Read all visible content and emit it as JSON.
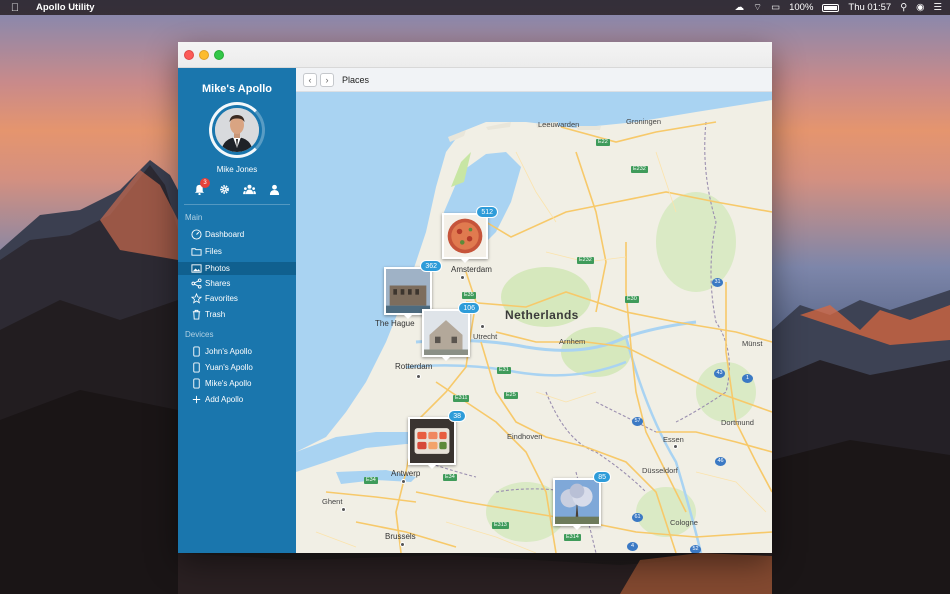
{
  "menubar": {
    "app_name": "Apollo Utility",
    "battery": "100%",
    "clock": "Thu 01:57"
  },
  "sidebar": {
    "title": "Mike's Apollo",
    "user_name": "Mike Jones",
    "notification_count": "3",
    "main_section": "Main",
    "main_items": [
      {
        "label": "Dashboard",
        "icon": "dashboard-icon"
      },
      {
        "label": "Files",
        "icon": "folder-icon"
      },
      {
        "label": "Photos",
        "icon": "photo-icon"
      },
      {
        "label": "Shares",
        "icon": "share-icon"
      },
      {
        "label": "Favorites",
        "icon": "star-icon"
      },
      {
        "label": "Trash",
        "icon": "trash-icon"
      }
    ],
    "selected": "Photos",
    "devices_section": "Devices",
    "devices": [
      {
        "label": "John's Apollo",
        "icon": "device-icon"
      },
      {
        "label": "Yuan's Apollo",
        "icon": "device-icon"
      },
      {
        "label": "Mike's Apollo",
        "icon": "device-icon"
      },
      {
        "label": "Add Apollo",
        "icon": "plus-icon"
      }
    ]
  },
  "toolbar": {
    "back": "‹",
    "forward": "›",
    "title": "Places"
  },
  "map": {
    "country": "Netherlands",
    "cities": [
      "Leeuwarden",
      "Groningen",
      "Amsterdam",
      "The Hague",
      "Utrecht",
      "Rotterdam",
      "Arnhem",
      "Eindhoven",
      "Antwerp",
      "Ghent",
      "Brussels",
      "Essen",
      "Dortmund",
      "Düsseldorf",
      "Cologne",
      "Münst"
    ],
    "roads": [
      "E22",
      "E232",
      "E232",
      "E30",
      "E35",
      "E31",
      "E311",
      "E25",
      "E34",
      "E34",
      "E313",
      "E314"
    ],
    "highways": [
      "31",
      "43",
      "1",
      "57",
      "46",
      "61",
      "4",
      "52"
    ],
    "photo_clusters": [
      {
        "count": "512",
        "subject": "pizza"
      },
      {
        "count": "362",
        "subject": "building"
      },
      {
        "count": "106",
        "subject": "house"
      },
      {
        "count": "38",
        "subject": "sushi"
      },
      {
        "count": "85",
        "subject": "tree"
      }
    ]
  },
  "colors": {
    "sidebar": "#1a76ad",
    "sidebar_selected": "#10608f",
    "accent": "#2e9cd9",
    "badge": "#e5413a",
    "water": "#a9d3f2",
    "land": "#f1efe5"
  }
}
